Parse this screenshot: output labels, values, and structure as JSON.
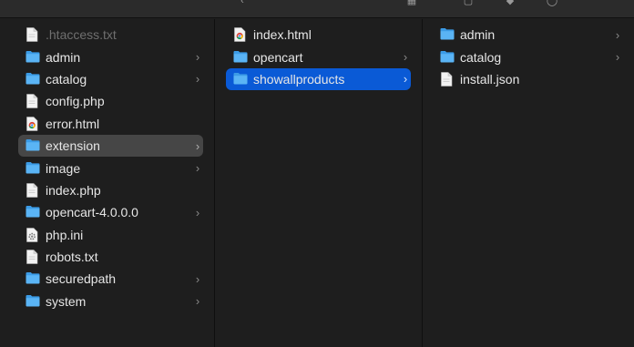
{
  "columns": [
    {
      "items": [
        {
          "label": ".htaccess.txt",
          "type": "file",
          "dim": true,
          "chevron": false
        },
        {
          "label": "admin",
          "type": "folder",
          "chevron": true
        },
        {
          "label": "catalog",
          "type": "folder",
          "chevron": true
        },
        {
          "label": "config.php",
          "type": "file",
          "chevron": false
        },
        {
          "label": "error.html",
          "type": "chrome",
          "chevron": false
        },
        {
          "label": "extension",
          "type": "folder",
          "chevron": true,
          "selected": "gray"
        },
        {
          "label": "image",
          "type": "folder",
          "chevron": true
        },
        {
          "label": "index.php",
          "type": "file",
          "chevron": false
        },
        {
          "label": "opencart-4.0.0.0",
          "type": "folder",
          "chevron": true
        },
        {
          "label": "php.ini",
          "type": "gear",
          "chevron": false
        },
        {
          "label": "robots.txt",
          "type": "file",
          "chevron": false
        },
        {
          "label": "securedpath",
          "type": "folder",
          "chevron": true
        },
        {
          "label": "system",
          "type": "folder",
          "chevron": true
        }
      ]
    },
    {
      "items": [
        {
          "label": "index.html",
          "type": "chrome",
          "chevron": false
        },
        {
          "label": "opencart",
          "type": "folder",
          "chevron": true
        },
        {
          "label": "showallproducts",
          "type": "folder",
          "chevron": true,
          "selected": "blue"
        }
      ]
    },
    {
      "items": [
        {
          "label": "admin",
          "type": "folder",
          "chevron": true
        },
        {
          "label": "catalog",
          "type": "folder",
          "chevron": true
        },
        {
          "label": "install.json",
          "type": "file",
          "chevron": false
        }
      ]
    }
  ],
  "chevron_glyph": "›",
  "colors": {
    "folder": "#4aa8f0",
    "selected_blue": "#0a5ad6",
    "selected_gray": "#464646"
  }
}
